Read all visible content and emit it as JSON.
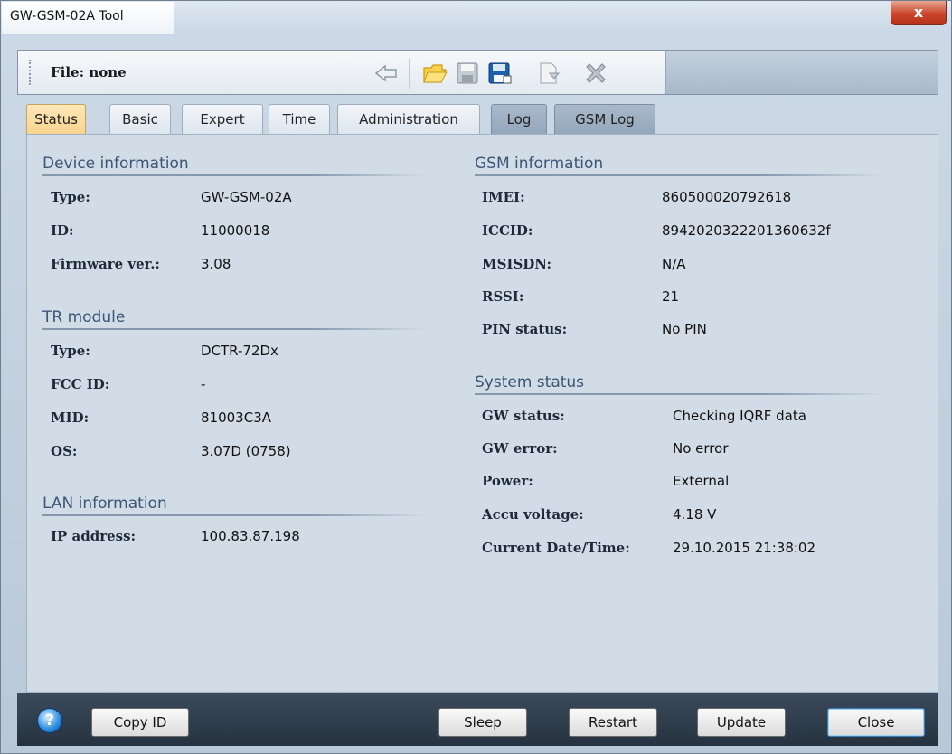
{
  "window": {
    "title": "GW-GSM-02A Tool",
    "close_glyph": "x"
  },
  "toolbar": {
    "file_label": "File: none",
    "icons": [
      "back-arrow-icon",
      "open-folder-icon",
      "save-icon",
      "save-as-icon",
      "export-icon",
      "delete-icon"
    ]
  },
  "tabs": [
    {
      "label": "Status"
    },
    {
      "label": "Basic"
    },
    {
      "label": "Expert"
    },
    {
      "label": "Time"
    },
    {
      "label": "Administration"
    },
    {
      "label": "Log"
    },
    {
      "label": "GSM Log"
    }
  ],
  "device": {
    "title": "Device information",
    "rows": [
      {
        "label": "Type:",
        "value": "GW-GSM-02A"
      },
      {
        "label": "ID:",
        "value": "11000018"
      },
      {
        "label": "Firmware ver.:",
        "value": "3.08"
      }
    ]
  },
  "tr": {
    "title": "TR module",
    "rows": [
      {
        "label": "Type:",
        "value": "DCTR-72Dx"
      },
      {
        "label": "FCC ID:",
        "value": "-"
      },
      {
        "label": "MID:",
        "value": "81003C3A"
      },
      {
        "label": "OS:",
        "value": "3.07D (0758)"
      }
    ]
  },
  "lan": {
    "title": "LAN information",
    "rows": [
      {
        "label": "IP address:",
        "value": "100.83.87.198"
      }
    ]
  },
  "gsm": {
    "title": "GSM information",
    "rows": [
      {
        "label": "IMEI:",
        "value": "860500020792618"
      },
      {
        "label": "ICCID:",
        "value": "8942020322201360632f"
      },
      {
        "label": "MSISDN:",
        "value": "N/A"
      },
      {
        "label": "RSSI:",
        "value": "21"
      },
      {
        "label": "PIN status:",
        "value": "No PIN"
      }
    ]
  },
  "system": {
    "title": "System status",
    "rows": [
      {
        "label": "GW status:",
        "value": "Checking IQRF data"
      },
      {
        "label": "GW error:",
        "value": "No error"
      },
      {
        "label": "Power:",
        "value": "External"
      },
      {
        "label": "Accu voltage:",
        "value": "4.18 V"
      },
      {
        "label": "Current Date/Time:",
        "value": "29.10.2015 21:38:02"
      }
    ]
  },
  "bottom": {
    "help_glyph": "?",
    "copy_id": "Copy ID",
    "sleep": "Sleep",
    "restart": "Restart",
    "update": "Update",
    "close": "Close"
  }
}
